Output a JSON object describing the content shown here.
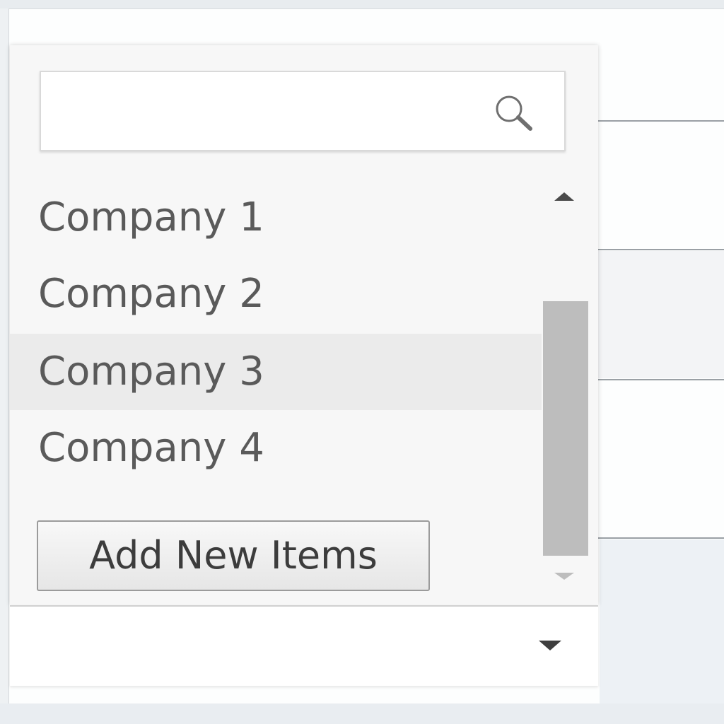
{
  "search": {
    "value": "",
    "placeholder": ""
  },
  "list": {
    "items": [
      {
        "label": "Company 1"
      },
      {
        "label": "Company 2"
      },
      {
        "label": "Company 3"
      },
      {
        "label": "Company 4"
      }
    ],
    "selected_index": 2
  },
  "add_button": {
    "label": "Add New Items"
  },
  "combo": {
    "value": ""
  },
  "icons": {
    "search": "search-icon",
    "scroll_up": "chevron-up-icon",
    "scroll_down": "chevron-down-icon",
    "combo_arrow": "caret-down-icon"
  },
  "colors": {
    "selected_row": "#ebebeb",
    "panel_bg": "#f7f7f7",
    "text": "#5a5a5a",
    "scroll_thumb": "#bdbdbd"
  }
}
